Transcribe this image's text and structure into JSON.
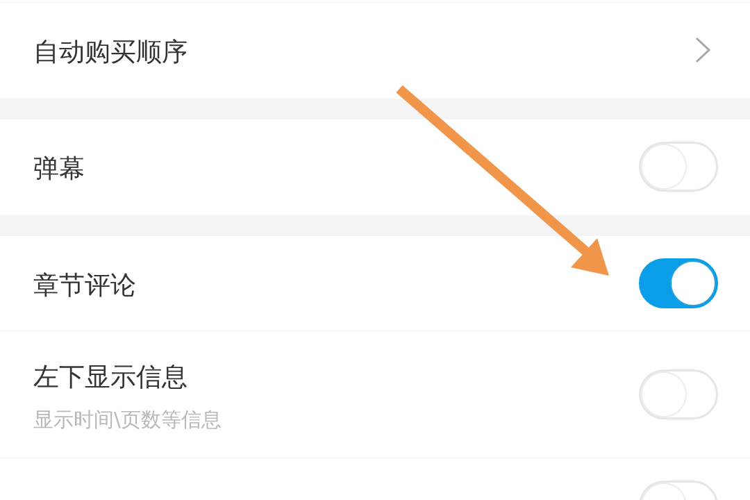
{
  "sections": [
    {
      "items": [
        {
          "kind": "link",
          "label": "自动购买顺序"
        }
      ]
    },
    {
      "items": [
        {
          "kind": "toggle",
          "label": "弹幕",
          "on": false
        }
      ]
    },
    {
      "items": [
        {
          "kind": "toggle",
          "label": "章节评论",
          "on": true
        },
        {
          "kind": "toggle",
          "label": "左下显示信息",
          "description": "显示时间\\页数等信息",
          "on": false
        },
        {
          "kind": "toggle",
          "on": false
        }
      ]
    }
  ]
}
